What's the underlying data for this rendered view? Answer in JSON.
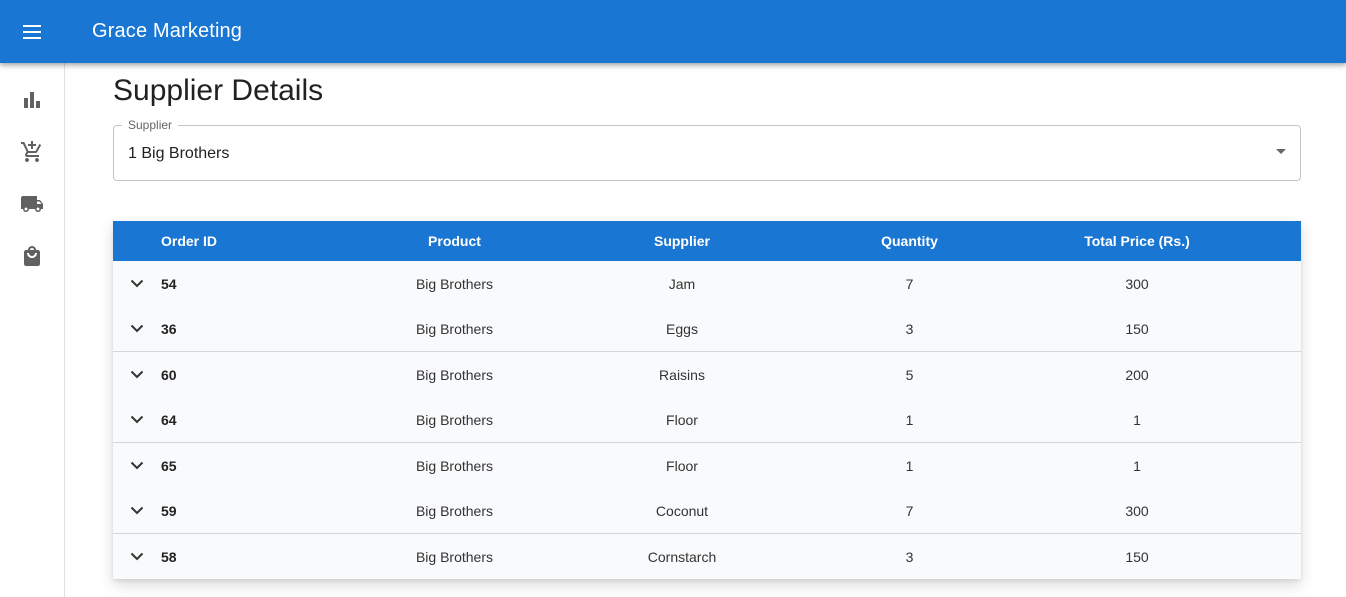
{
  "app": {
    "title": "Grace Marketing",
    "menu_icon": "menu-icon"
  },
  "sidebar": {
    "items": [
      {
        "icon": "bar-chart-icon"
      },
      {
        "icon": "add-shopping-cart-icon"
      },
      {
        "icon": "local-shipping-icon"
      },
      {
        "icon": "shopping-bag-icon"
      }
    ]
  },
  "page": {
    "title": "Supplier Details"
  },
  "supplier_select": {
    "label": "Supplier",
    "value": "1 Big Brothers"
  },
  "table": {
    "headers": {
      "order_id": "Order ID",
      "product": "Product",
      "supplier": "Supplier",
      "quantity": "Quantity",
      "total_price": "Total Price (Rs.)"
    },
    "rows": [
      {
        "order_id": "54",
        "product": "Big Brothers",
        "supplier": "Jam",
        "quantity": "7",
        "total_price": "300"
      },
      {
        "order_id": "36",
        "product": "Big Brothers",
        "supplier": "Eggs",
        "quantity": "3",
        "total_price": "150"
      },
      {
        "order_id": "60",
        "product": "Big Brothers",
        "supplier": "Raisins",
        "quantity": "5",
        "total_price": "200"
      },
      {
        "order_id": "64",
        "product": "Big Brothers",
        "supplier": "Floor",
        "quantity": "1",
        "total_price": "1"
      },
      {
        "order_id": "65",
        "product": "Big Brothers",
        "supplier": "Floor",
        "quantity": "1",
        "total_price": "1"
      },
      {
        "order_id": "59",
        "product": "Big Brothers",
        "supplier": "Coconut",
        "quantity": "7",
        "total_price": "300"
      },
      {
        "order_id": "58",
        "product": "Big Brothers",
        "supplier": "Cornstarch",
        "quantity": "3",
        "total_price": "150"
      }
    ]
  },
  "colors": {
    "primary": "#1976d2",
    "table_bg": "#f9fafc",
    "icon_gray": "#616161"
  }
}
